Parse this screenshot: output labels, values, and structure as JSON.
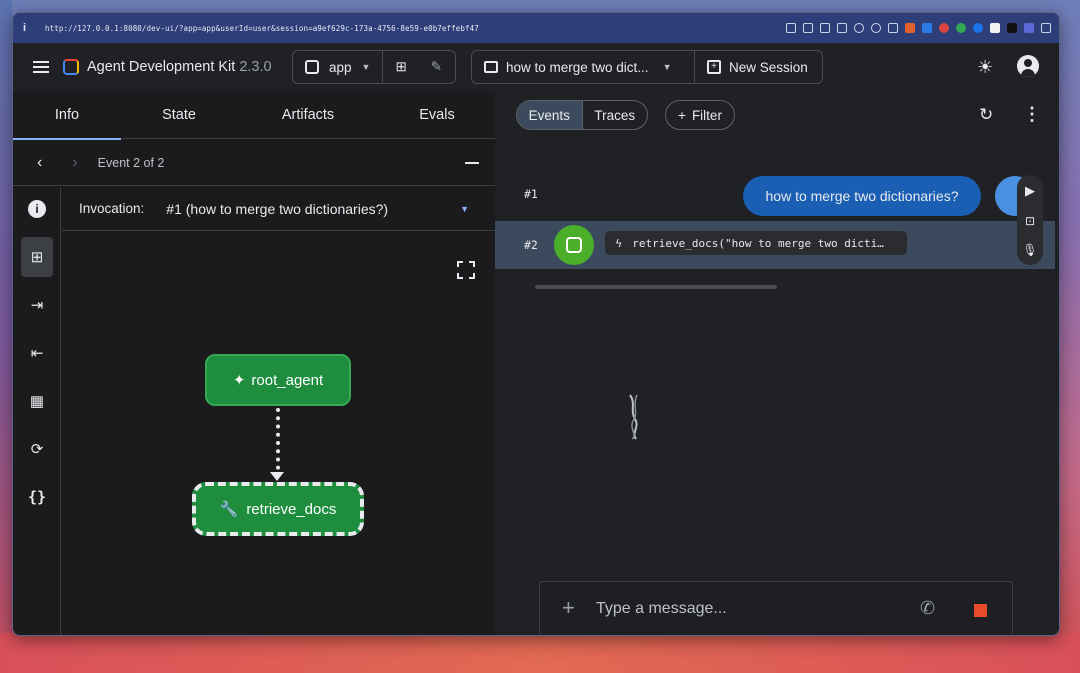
{
  "browser": {
    "url": "http://127.0.0.1:8080/dev-ui/?app=app&userId=user&session=a9ef629c-173a-4756-8e59-e0b7effebf47"
  },
  "header": {
    "title": "Agent Development Kit",
    "version": "2.3.0",
    "app_selector": "app",
    "session_title": "how to merge two dict...",
    "new_session_label": "New Session"
  },
  "left_panel": {
    "tabs": [
      "Info",
      "State",
      "Artifacts",
      "Evals"
    ],
    "active_tab": "Info",
    "event_label": "Event 2 of 2",
    "invocation_label": "Invocation:",
    "invocation_value": "#1 (how to merge two dictionaries?)",
    "graph": {
      "root_node": "root_agent",
      "tool_node": "retrieve_docs"
    }
  },
  "right_panel": {
    "toggle": [
      "Events",
      "Traces"
    ],
    "active_toggle": "Events",
    "filter_label": "Filter",
    "events": [
      {
        "num": "#1",
        "text": "how to merge two dictionaries?"
      },
      {
        "num": "#2",
        "text": "retrieve_docs(\"how to merge two dicti…"
      }
    ],
    "composer_placeholder": "Type a message..."
  },
  "colors": {
    "accent": "#8ab4f8",
    "node_green": "#1e8e3e",
    "user_bubble": "#1a5fb4",
    "stop_red": "#e84b2c"
  }
}
